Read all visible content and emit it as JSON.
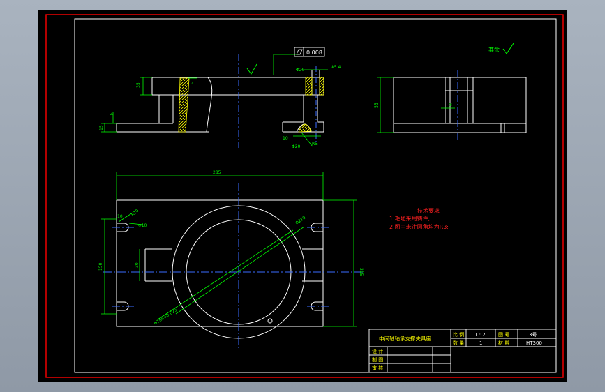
{
  "drawing": {
    "flatness_tolerance": "0.008",
    "surface_finish_label": "其余",
    "dims": {
      "top_left_height": "35",
      "left_step_small": "4",
      "left_base_height": "15",
      "hole_top_dia": "Φ20",
      "hole_right_dia": "Φ5.4",
      "top_bottom_left": "4",
      "hole_bottom_1": "10",
      "hole_bottom_2": "Φ20",
      "hole_bottom_3": "R5",
      "side_height": "55",
      "side_slot_width": "8",
      "plan_width": "285",
      "plan_height": "215",
      "plan_left_height": "150",
      "slot_width": "10",
      "slot_radius": "R10",
      "slot_dia": "Φ10",
      "boss_width": "30",
      "bore_dia": "Φ210",
      "outer_dia": "Φ185+0.025"
    },
    "notes": {
      "title": "技术要求",
      "line1": "1.毛坯采用铸件;",
      "line2": "2.图中未注圆角均为R3;"
    },
    "title_block": {
      "part_name": "中间轴轴承支撑夹具座",
      "scale_label": "比 例",
      "scale_value": "1 : 2",
      "drawing_no_label": "图 号",
      "drawing_no_value": "3号",
      "quantity_label": "数 量",
      "quantity_value": "1",
      "material_label": "材 料",
      "material_value": "HT300",
      "design_label": "设 计",
      "draw_label": "制 图",
      "review_label": "审 核"
    }
  }
}
